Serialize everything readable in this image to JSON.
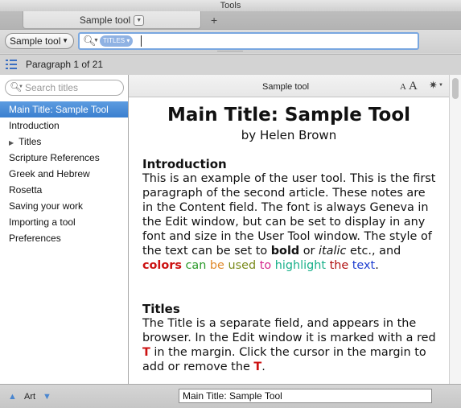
{
  "window": {
    "title": "Tools"
  },
  "tabs": [
    {
      "label": "Sample tool"
    }
  ],
  "tab_bar": {
    "add_tab_glyph": "+"
  },
  "toolbar": {
    "tool_select": {
      "value": "Sample tool"
    },
    "search": {
      "scope_token": "TITLES",
      "value": ""
    }
  },
  "paragraph_bar": {
    "label": "Paragraph 1 of 21"
  },
  "sidebar": {
    "search_placeholder": "Search titles",
    "items": [
      {
        "label": "Main Title: Sample Tool",
        "selected": true
      },
      {
        "label": "Introduction"
      },
      {
        "label": "Titles",
        "has_children": true
      },
      {
        "label": "Scripture References"
      },
      {
        "label": "Greek and Hebrew"
      },
      {
        "label": "Rosetta"
      },
      {
        "label": "Saving your work"
      },
      {
        "label": "Importing a tool"
      },
      {
        "label": "Preferences"
      }
    ]
  },
  "content_header": {
    "title": "Sample tool",
    "font_smaller": "A",
    "font_larger": "A"
  },
  "document": {
    "title": "Main Title: Sample Tool",
    "author": "by Helen Brown",
    "sections": [
      {
        "heading": "Introduction",
        "text_plain": "This is an example of the user tool. This is the first paragraph of the second article. These notes are in the Content field. The font is always Geneva in the Edit window, but can be set to display in any font and size in the User Tool window. The style of the text can be set to ",
        "bold": "bold",
        "or": " or ",
        "italic": "italic",
        "etc": " etc., and ",
        "colors": "colors",
        "can": "can",
        "be": "be",
        "used": "used",
        "to": "to",
        "highlight": "highlight",
        "the": "the",
        "text": "text",
        "end": "."
      },
      {
        "heading": "Titles",
        "text_plain": "The Title is a separate field, and appears in the browser. In the Edit window it is marked with a red ",
        "marker1": "T",
        "text_middle": " in the margin. Click the cursor in the margin to add or remove the ",
        "marker2": "T",
        "end": "."
      }
    ]
  },
  "colors": {
    "selection": "#3a7fcf",
    "red": "#cc1111",
    "green": "#2a9a2a",
    "orange": "#e0892a",
    "olive": "#7a8a1a",
    "magenta": "#d4268c",
    "teal": "#18b08a",
    "dark_red": "#b01010",
    "blue": "#1f3fd1"
  },
  "bottom_bar": {
    "art_label": "Art",
    "status_value": "Main Title: Sample Tool"
  },
  "icons": {
    "search": "magnifier-icon",
    "paragraph": "list-icon",
    "gear": "gear-icon",
    "up": "up-triangle-icon",
    "down": "down-triangle-icon"
  }
}
